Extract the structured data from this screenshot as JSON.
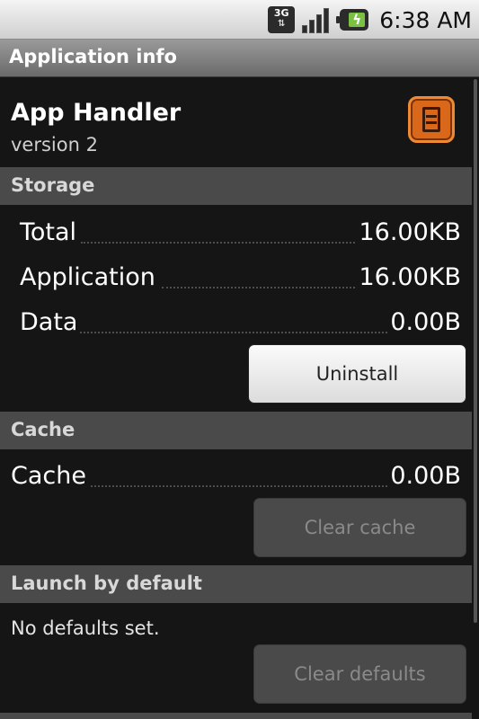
{
  "status_bar": {
    "network_label": "3G",
    "network_arrows": "⇅",
    "time": "6:38 AM"
  },
  "title_bar": {
    "title": "Application info"
  },
  "app": {
    "name": "App Handler",
    "version": "version 2"
  },
  "storage": {
    "header": "Storage",
    "rows": [
      {
        "label": "Total",
        "value": "16.00KB"
      },
      {
        "label": "Application",
        "value": "16.00KB"
      },
      {
        "label": "Data",
        "value": "0.00B"
      }
    ],
    "uninstall_label": "Uninstall"
  },
  "cache": {
    "header": "Cache",
    "row": {
      "label": "Cache",
      "value": "0.00B"
    },
    "clear_label": "Clear cache"
  },
  "launch": {
    "header": "Launch by default",
    "message": "No defaults set.",
    "clear_label": "Clear defaults"
  },
  "colors": {
    "background": "#151515",
    "section_header": "#4a4a4a",
    "battery_green": "#7ac142",
    "app_icon_orange": "#d9681a"
  }
}
